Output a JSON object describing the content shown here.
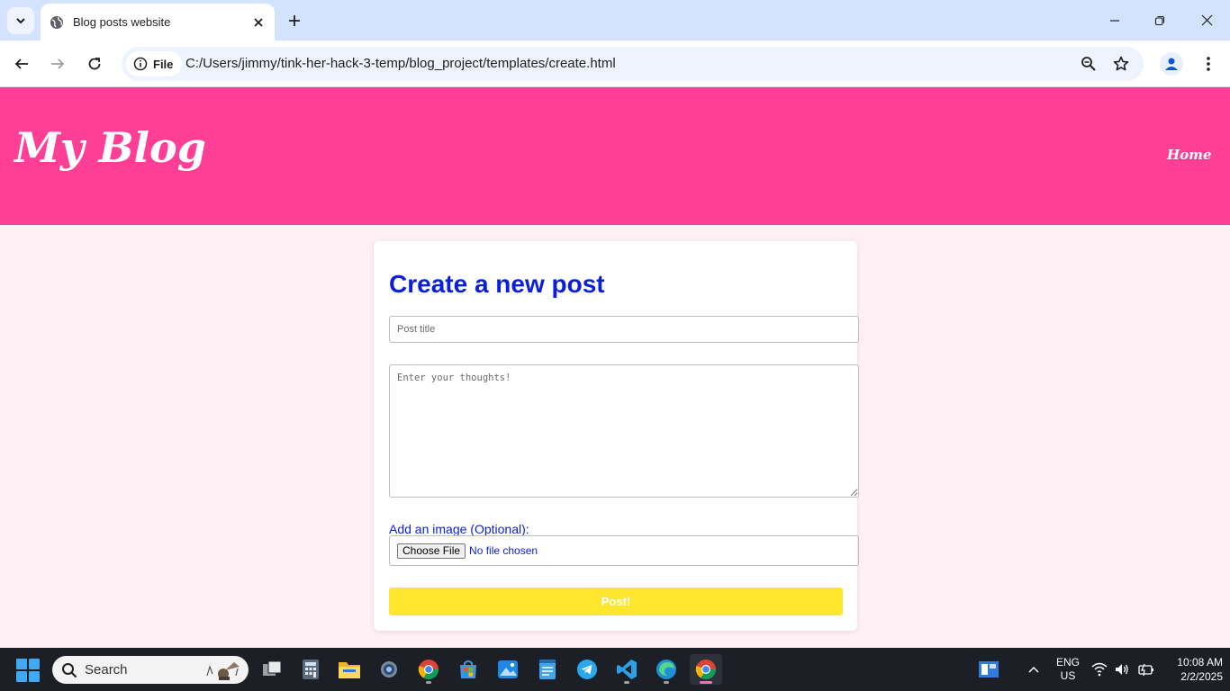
{
  "browser": {
    "tab_title": "Blog posts website",
    "site_chip_label": "File",
    "url": "C:/Users/jimmy/tink-her-hack-3-temp/blog_project/templates/create.html"
  },
  "site": {
    "logo": "My Blog",
    "nav_home": "Home",
    "header_color": "#ff3e96",
    "background_color": "#fff0f6"
  },
  "form": {
    "heading": "Create a new post",
    "title_placeholder": "Post title",
    "title_value": "",
    "content_placeholder": "Enter your thoughts!",
    "content_value": "",
    "image_label": "Add an image (Optional):",
    "choose_file_label": "Choose File",
    "file_status": "No file chosen",
    "submit_label": "Post!",
    "accent_color": "#0a1fd6",
    "submit_color": "#ffe62e"
  },
  "taskbar": {
    "search_label": "Search",
    "apps": [
      "task-view",
      "calculator",
      "file-explorer",
      "settings",
      "chrome",
      "microsoft-store",
      "photos",
      "notepad",
      "telegram",
      "vscode",
      "edge",
      "chrome-active"
    ],
    "language_line1": "ENG",
    "language_line2": "US",
    "time": "10:08 AM",
    "date": "2/2/2025"
  }
}
